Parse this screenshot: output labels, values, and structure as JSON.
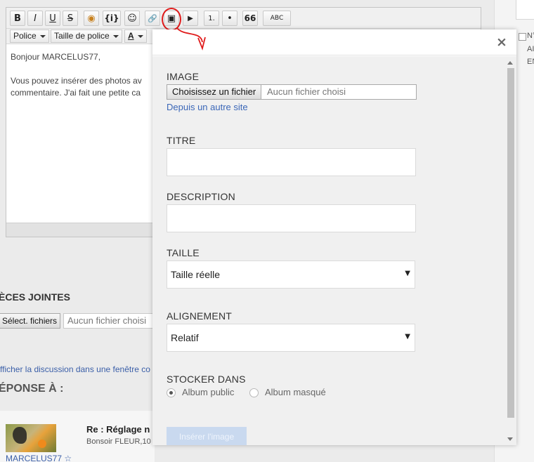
{
  "background": {
    "toolbar_row1": [
      "B",
      "I",
      "U",
      "S",
      "◉",
      "{i}",
      "☺",
      "🔗",
      "▣",
      "▶",
      "1.",
      "•",
      "66",
      "ABC"
    ],
    "toolbar_row2": {
      "font": "Police",
      "size": "Taille de police",
      "color": "A"
    },
    "editor_lines": [
      "Bonjour MARCELUS77,",
      "Vous pouvez insérer des photos av",
      "commentaire. J'ai fait une petite ca"
    ],
    "attachments_title": "ÈCES JOINTES",
    "select_files": "Sélect. fichiers",
    "no_file": "Aucun fichier choisi",
    "view_link": "fficher la discussion dans une fenêtre co",
    "reply_to": "ÉPONSE À :",
    "post": {
      "title": "Re : Réglage n",
      "excerpt": "Bonsoir FLEUR,10",
      "author": "MARCELUS77 ☆"
    },
    "right_col": [
      "N°",
      "AI",
      "EN"
    ]
  },
  "modal": {
    "close": "×",
    "image_label": "IMAGE",
    "choose_file": "Choisissez un fichier",
    "no_file": "Aucun fichier choisi",
    "other_site": "Depuis un autre site",
    "title_label": "TITRE",
    "description_label": "DESCRIPTION",
    "size_label": "TAILLE",
    "size_value": "Taille réelle",
    "align_label": "ALIGNEMENT",
    "align_value": "Relatif",
    "store_label": "STOCKER DANS",
    "store_options": [
      "Album public",
      "Album masqué"
    ],
    "store_selected": "Album public",
    "insert_button": "Insérer l'image",
    "select_arrow": "▼"
  },
  "colors": {
    "annotation": "#e01b1b",
    "link": "#3b67b8",
    "insert_button_bg": "#c9d9ef"
  }
}
